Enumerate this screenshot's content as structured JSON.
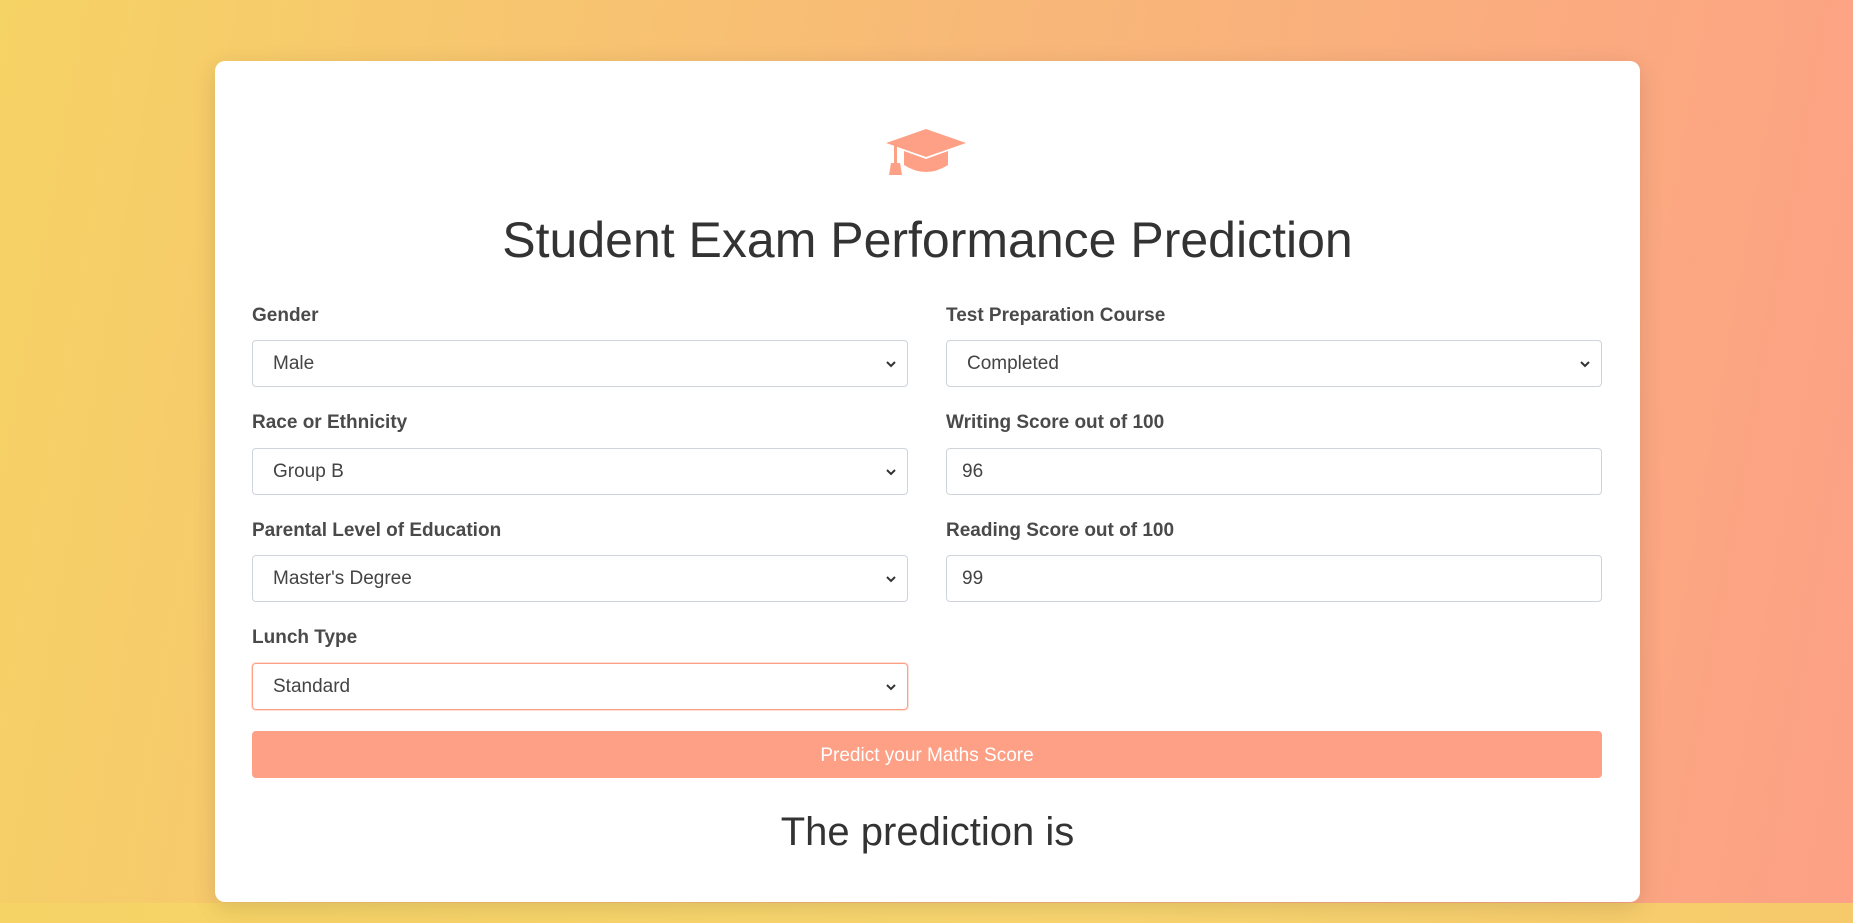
{
  "page": {
    "title": "Student Exam Performance Prediction",
    "icon": "graduation-cap-icon",
    "accent_color": "#fda085",
    "background_gradient": [
      "#f6d365",
      "#fda085"
    ]
  },
  "form": {
    "gender": {
      "label": "Gender",
      "value": "Male"
    },
    "race": {
      "label": "Race or Ethnicity",
      "value": "Group B"
    },
    "parental_education": {
      "label": "Parental Level of Education",
      "value": "Master's Degree"
    },
    "lunch": {
      "label": "Lunch Type",
      "value": "Standard"
    },
    "test_prep": {
      "label": "Test Preparation Course",
      "value": "Completed"
    },
    "writing_score": {
      "label": "Writing Score out of 100",
      "value": "96"
    },
    "reading_score": {
      "label": "Reading Score out of 100",
      "value": "99"
    },
    "submit_label": "Predict your Maths Score"
  },
  "result": {
    "text": "The prediction is"
  }
}
